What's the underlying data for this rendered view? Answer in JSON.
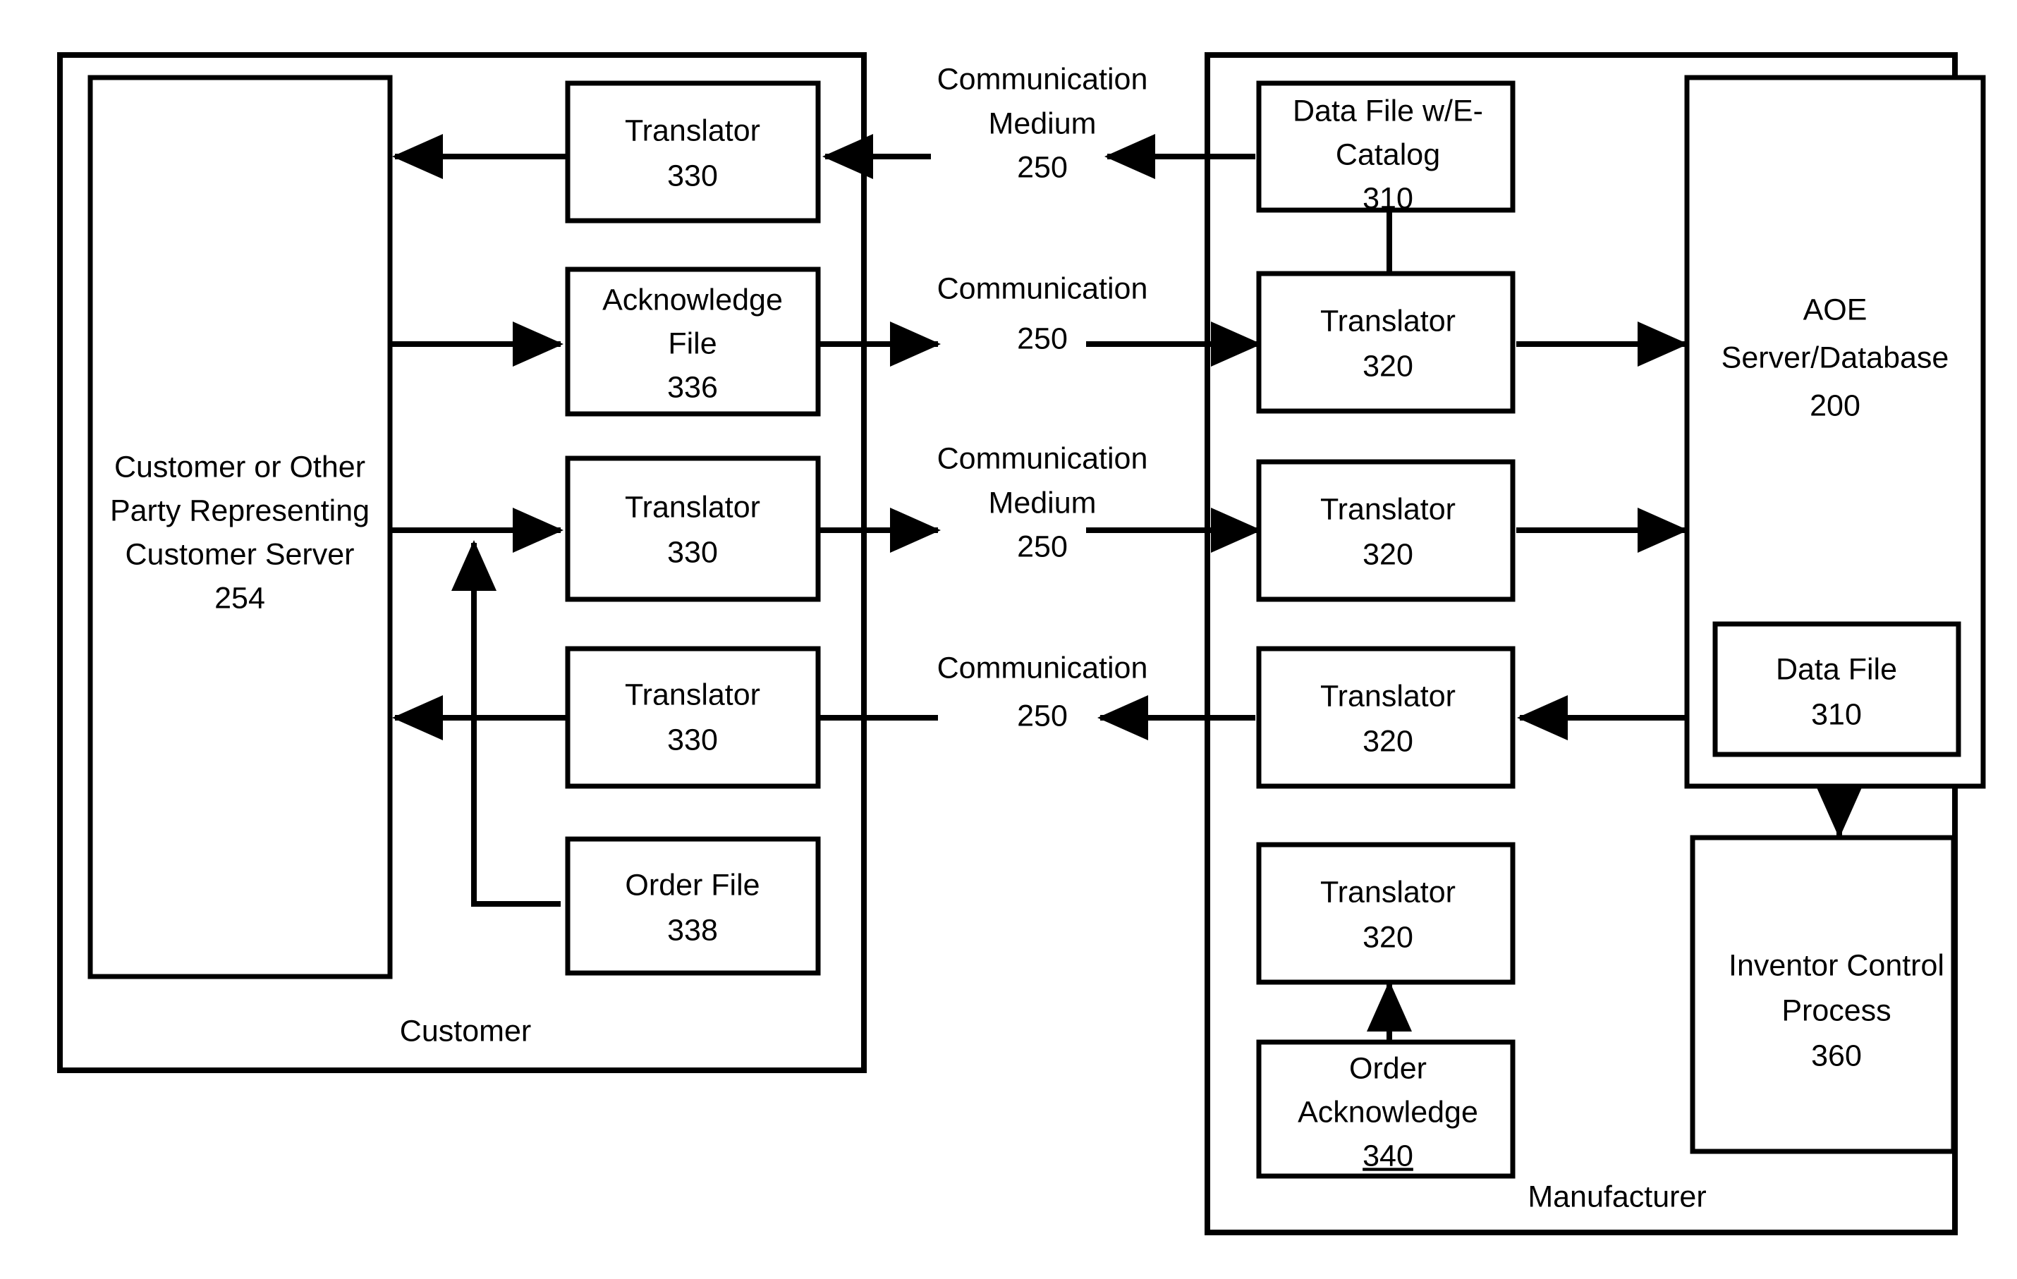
{
  "figure": {
    "type": "patent-block-diagram",
    "background_color": "#ffffff",
    "line_color": "#000000"
  },
  "containers": {
    "customer": {
      "label": "Customer"
    },
    "manufacturer": {
      "label": "Manufacturer"
    },
    "aoe": {
      "line1": "AOE",
      "line2": "Server/Database",
      "line3": "200"
    }
  },
  "customer_side": {
    "server": {
      "line1": "Customer or Other",
      "line2": "Party Representing",
      "line3": "Customer Server",
      "line4": "254"
    },
    "boxes": [
      {
        "id": "translator-330-a",
        "line1": "Translator",
        "line2": "330"
      },
      {
        "id": "acknowledge-file-336",
        "line1": "Acknowledge",
        "line2": "File",
        "line3": "336"
      },
      {
        "id": "translator-330-b",
        "line1": "Translator",
        "line2": "330"
      },
      {
        "id": "translator-330-c",
        "line1": "Translator",
        "line2": "330"
      },
      {
        "id": "order-file-338",
        "line1": "Order File",
        "line2": "338"
      }
    ]
  },
  "manufacturer_side": {
    "boxes": [
      {
        "id": "data-file-ecatalog-310",
        "line1": "Data File w/E-",
        "line2": "Catalog",
        "line3": "310"
      },
      {
        "id": "translator-320-a",
        "line1": "Translator",
        "line2": "320"
      },
      {
        "id": "translator-320-b",
        "line1": "Translator",
        "line2": "320"
      },
      {
        "id": "translator-320-c",
        "line1": "Translator",
        "line2": "320"
      },
      {
        "id": "translator-320-d",
        "line1": "Translator",
        "line2": "320"
      },
      {
        "id": "order-acknowledge-340",
        "line1": "Order",
        "line2": "Acknowledge",
        "line3": "340",
        "line3_underlined": true
      }
    ],
    "aoe_children": [
      {
        "id": "data-file-310",
        "line1": "Data File",
        "line2": "310"
      }
    ],
    "inventory": {
      "line1": "Inventor Control",
      "line2": "Process",
      "line3": "360"
    }
  },
  "communication_labels": [
    {
      "id": "comm-medium-250-row1",
      "line1": "Communication",
      "line2": "Medium",
      "line3": "250"
    },
    {
      "id": "comm-250-row2",
      "line1": "Communication",
      "line2": "250"
    },
    {
      "id": "comm-medium-250-row3",
      "line1": "Communication",
      "line2": "Medium",
      "line3": "250"
    },
    {
      "id": "comm-250-row4",
      "line1": "Communication",
      "line2": "250"
    }
  ]
}
